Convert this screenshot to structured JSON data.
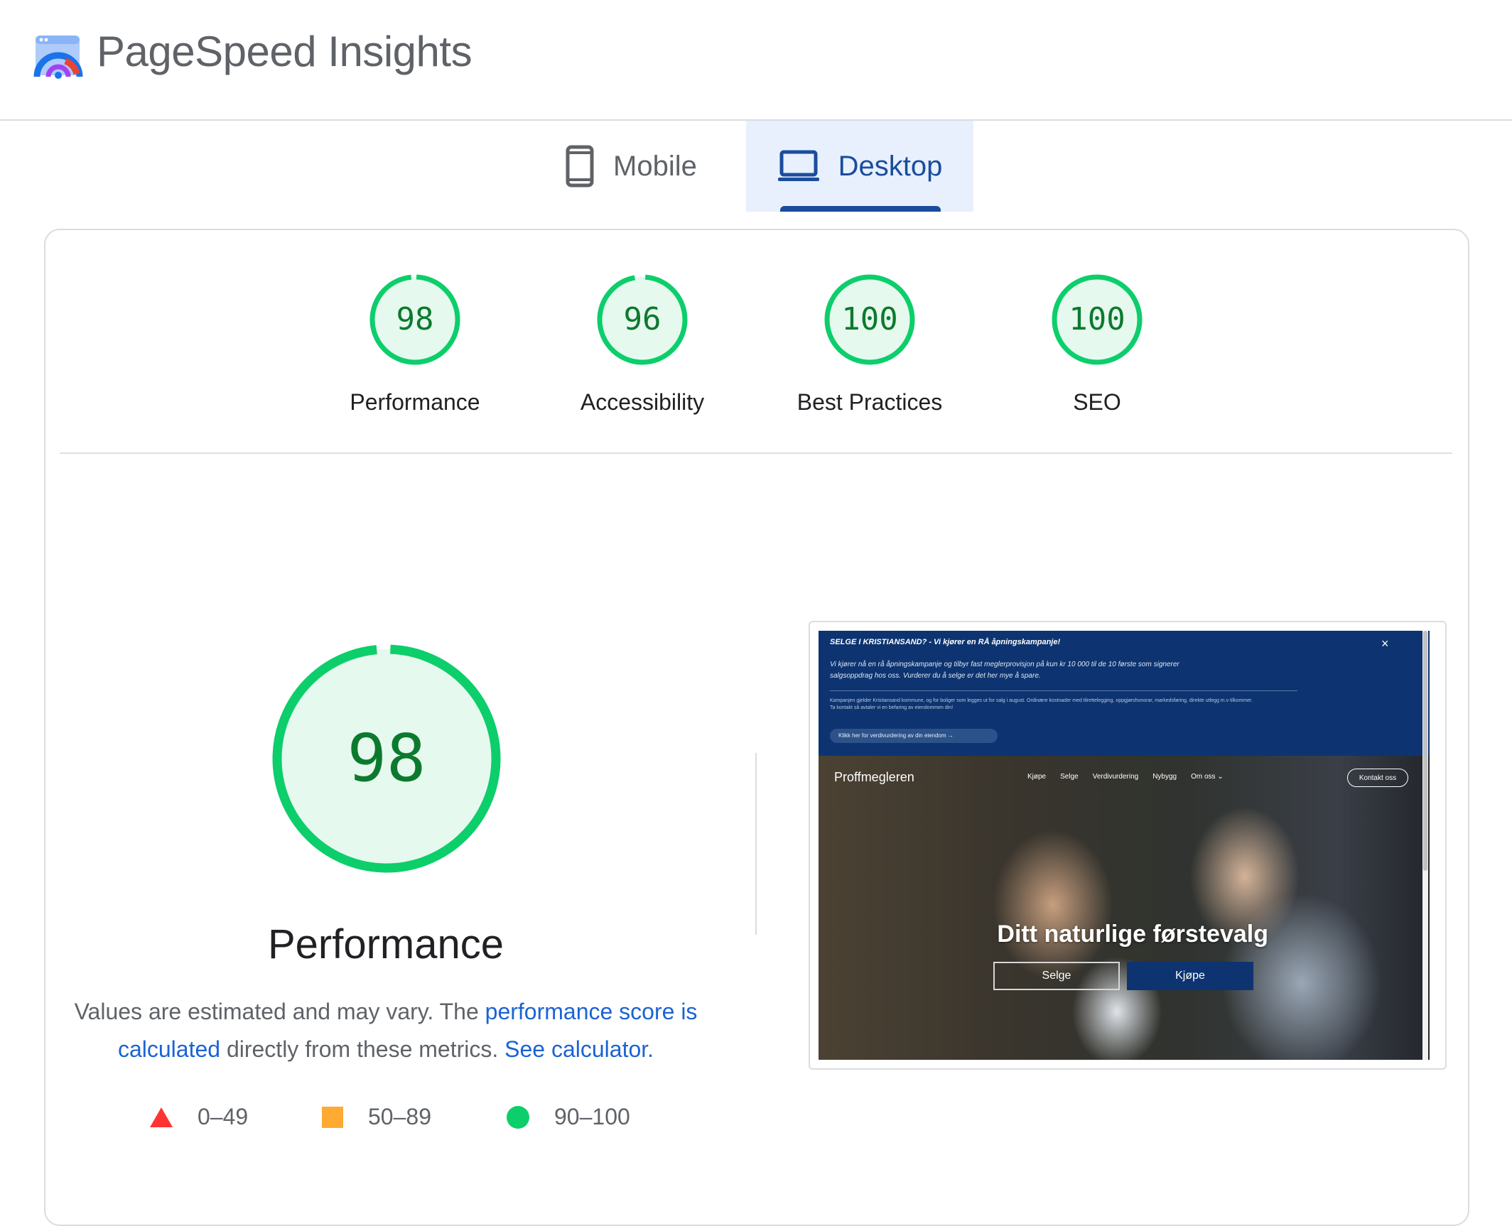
{
  "app": {
    "title": "PageSpeed Insights"
  },
  "tabs": [
    {
      "label": "Mobile",
      "icon": "phone-icon",
      "selected": false
    },
    {
      "label": "Desktop",
      "icon": "laptop-icon",
      "selected": true
    }
  ],
  "categories": [
    {
      "name": "Performance",
      "score": "98"
    },
    {
      "name": "Accessibility",
      "score": "96"
    },
    {
      "name": "Best Practices",
      "score": "100"
    },
    {
      "name": "SEO",
      "score": "100"
    }
  ],
  "performance": {
    "score": "98",
    "title": "Performance",
    "desc_pre": "Values are estimated and may vary. The ",
    "desc_link1": "performance score is calculated",
    "desc_mid": " directly from these metrics. ",
    "desc_link2": "See calculator."
  },
  "legend": [
    {
      "range": "0–49",
      "shape": "triangle",
      "color": "#ff3333"
    },
    {
      "range": "50–89",
      "shape": "square",
      "color": "#ffaa33"
    },
    {
      "range": "90–100",
      "shape": "circle",
      "color": "#0cce6b"
    }
  ],
  "colors": {
    "pass": "#0cce6b",
    "pass_fill": "#e6f9ee",
    "score_text": "#0c7a2e",
    "accent": "#1a4d9c",
    "link": "#1a63d4"
  },
  "preview": {
    "banner_title": "SELGE I KRISTIANSAND? - Vi kjører en RÅ åpningskampanje!",
    "banner_text1": "Vi kjører nå en rå åpningskampanje og tilbyr fast meglerprovisjon på kun kr 10 000 til de 10 første som signerer salgsoppdrag hos oss. Vurderer du å selge er det her mye å spare.",
    "banner_text2": "Kampanjen gjelder Kristiansand kommune, og for boliger som legges ut for salg i august. Ordinære kostnader med tilrettelegging, oppgjørshonorar, markedsføring, direkte utlegg m.v tilkommer. Ta kontakt så avtaler vi en befaring av eiendommen din!",
    "banner_button": "Klikk her for verdivurdering av din eiendom →",
    "close": "×",
    "brand": "Proffmegleren",
    "nav": [
      "Kjøpe",
      "Selge",
      "Verdivurdering",
      "Nybygg",
      "Om oss ⌄"
    ],
    "contact": "Kontakt oss",
    "headline": "Ditt naturlige førstevalg",
    "btn_sell": "Selge",
    "btn_buy": "Kjøpe"
  }
}
